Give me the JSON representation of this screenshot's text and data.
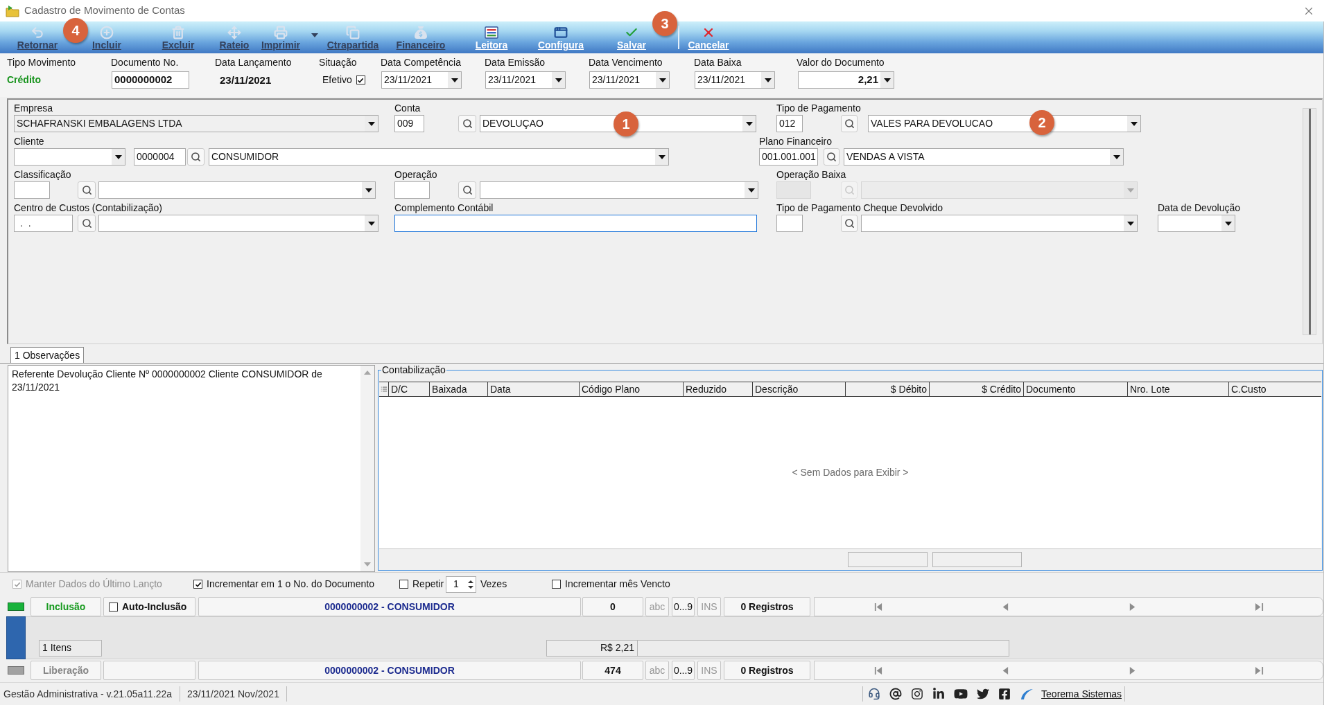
{
  "window": {
    "title": "Cadastro de Movimento de Contas"
  },
  "toolbar": {
    "buttons": [
      {
        "label": "Retornar",
        "disabled": true,
        "marker": "4"
      },
      {
        "label": "Incluir",
        "disabled": true
      },
      {
        "label": "Excluir",
        "disabled": true
      },
      {
        "label": "Rateio",
        "disabled": true
      },
      {
        "label": "Imprimir",
        "disabled": true,
        "dropdown": true
      },
      {
        "label": "Ctrapartida",
        "disabled": true
      },
      {
        "label": "Financeiro",
        "disabled": true
      },
      {
        "label": "Leitora",
        "disabled": false
      },
      {
        "label": "Configura",
        "disabled": false
      },
      {
        "label": "Salvar",
        "disabled": false,
        "marker": "3"
      },
      {
        "label": "Cancelar",
        "disabled": false,
        "separator_before": true
      }
    ]
  },
  "header": {
    "fields": [
      {
        "kind": "status",
        "label": "Tipo Movimento",
        "value": "Crédito"
      },
      {
        "kind": "input",
        "label": "Documento No.",
        "value": "0000000002"
      },
      {
        "kind": "static",
        "label": "Data Lançamento",
        "value": "23/11/2021"
      },
      {
        "kind": "check",
        "label": "Situação",
        "text": "Efetivo",
        "checked": true
      },
      {
        "kind": "date",
        "label": "Data Competência",
        "value": "23/11/2021"
      },
      {
        "kind": "date",
        "label": "Data Emissão",
        "value": "23/11/2021"
      },
      {
        "kind": "date",
        "label": "Data Vencimento",
        "value": "23/11/2021"
      },
      {
        "kind": "date",
        "label": "Data Baixa",
        "value": "23/11/2021"
      },
      {
        "kind": "amount",
        "label": "Valor do Documento",
        "value": "2,21"
      }
    ]
  },
  "form": {
    "empresa": {
      "label": "Empresa",
      "value": "SCHAFRANSKI EMBALAGENS LTDA"
    },
    "conta": {
      "label": "Conta",
      "code": "009",
      "value": "DEVOLUÇAO",
      "marker": "1"
    },
    "tipo_pagamento": {
      "label": "Tipo de Pagamento",
      "code": "012",
      "value": "VALES PARA DEVOLUCAO",
      "marker": "2"
    },
    "cliente": {
      "label": "Cliente",
      "code": "0000004",
      "value": "CONSUMIDOR"
    },
    "plano_financeiro": {
      "label": "Plano Financeiro",
      "code": "001.001.001",
      "value": "VENDAS A VISTA"
    },
    "classificacao": {
      "label": "Classificação"
    },
    "operacao": {
      "label": "Operação"
    },
    "operacao_baixa": {
      "label": "Operação Baixa",
      "disabled": true
    },
    "centro_custos": {
      "label": "Centro de Custos (Contabilização)",
      "code": ".  ."
    },
    "complemento_contabil": {
      "label": "Complemento Contábil",
      "focused": true
    },
    "tipo_pagamento_cheque": {
      "label": "Tipo de Pagamento Cheque Devolvido"
    },
    "data_devolucao": {
      "label": "Data de Devolução"
    }
  },
  "tabs": [
    {
      "label": "1 Observações",
      "selected": true
    }
  ],
  "notes": {
    "text": "Referente Devolução Cliente Nº 0000000002 Cliente CONSUMIDOR de 23/11/2021"
  },
  "accounting": {
    "title": "Contabilização",
    "columns": [
      {
        "label": "D/C"
      },
      {
        "label": "Baixada"
      },
      {
        "label": "Data"
      },
      {
        "label": "Código Plano"
      },
      {
        "label": "Reduzido"
      },
      {
        "label": "Descrição"
      },
      {
        "label": "$ Débito"
      },
      {
        "label": "$ Crédito"
      },
      {
        "label": "Documento"
      },
      {
        "label": "Nro. Lote"
      },
      {
        "label": "C.Custo"
      }
    ],
    "empty_message": "< Sem Dados para Exibir >"
  },
  "options": [
    {
      "kind": "check",
      "label": "Manter Dados do Último Lançto",
      "checked": true,
      "disabled": true
    },
    {
      "kind": "check",
      "label": "Incrementar em 1 o No. do Documento",
      "checked": true,
      "disabled": false
    },
    {
      "kind": "check",
      "label": "Repetir",
      "checked": false,
      "disabled": false
    },
    {
      "kind": "spinner",
      "value": "1"
    },
    {
      "kind": "text",
      "label": "Vezes"
    },
    {
      "kind": "check",
      "label": "Incrementar mês Vencto",
      "checked": false,
      "disabled": false
    }
  ],
  "bands": [
    {
      "kind": "navigator",
      "mode": "Inclusão",
      "active": true,
      "auto_include": {
        "label": "Auto-Inclusão",
        "checked": false
      },
      "record": "0000000002 - CONSUMIDOR",
      "count": "0",
      "indicators": [
        {
          "label": "abc",
          "on": false
        },
        {
          "label": "0...9",
          "on": true
        },
        {
          "label": "INS",
          "on": false
        }
      ],
      "records": "0 Registros"
    },
    {
      "kind": "summary",
      "items": "1 Itens",
      "total": "R$ 2,21"
    },
    {
      "kind": "navigator",
      "mode": "Liberação",
      "active": false,
      "record": "0000000002 - CONSUMIDOR",
      "count": "474",
      "indicators": [
        {
          "label": "abc",
          "on": false
        },
        {
          "label": "0...9",
          "on": true
        },
        {
          "label": "INS",
          "on": false
        }
      ],
      "records": "0 Registros"
    }
  ],
  "status_bar": {
    "version": "Gestão Administrativa - v.21.05a11.22a",
    "date": "23/11/2021 Nov/2021",
    "link": "Teorema Sistemas"
  }
}
